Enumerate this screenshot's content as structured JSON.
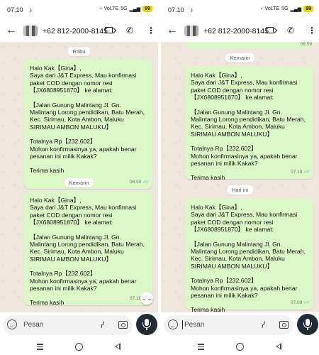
{
  "status_bar": {
    "time": "07.10",
    "battery": "99",
    "signal_labels": [
      "VoLTE",
      "5G"
    ]
  },
  "header": {
    "phone": "+62 812-2000-8145"
  },
  "icons": {
    "back": "arrow-back-icon",
    "label": "label-icon",
    "call": "add-call-icon",
    "menu": "more-vert-icon",
    "emoji": "emoji-icon",
    "attach": "attach-icon",
    "camera": "camera-icon",
    "mic": "mic-icon"
  },
  "message": {
    "greeting": "Halo Kak【Gina】,",
    "intro": "Saya dari J&T Express, Mau konfirmasi paket COD dengan nomor resi 【JX6808951870】 ke alamat:",
    "address": "【Jalan Gunung Malintang  Jl. Gn. Malintang Lorong pendidikan, Batu Merah, Kec. Sirimau, Kota Ambon, Maluku SIRIMAU AMBON MALUKU】",
    "total": "Totalnya Rp【232,602】",
    "ask": "Mohon konfirmasinya ya, apakah benar pesanan ini milik Kakak?",
    "thanks": "Terima kasih"
  },
  "left_pane": {
    "date_1": "Rabu",
    "time_1": "06.59",
    "date_2": "Kemarin",
    "time_2": "07.18"
  },
  "right_pane": {
    "partial_time": "06.59",
    "date_1": "Kemarin",
    "time_1": "07.18",
    "date_2": "Hari ini",
    "time_2": "07.09"
  },
  "composer": {
    "placeholder": "Pesan"
  },
  "colors": {
    "bubble": "#dcf8c6",
    "chat_bg": "#efe7dd",
    "ticks": "#4fb6ec",
    "mic_button": "#1f2c34",
    "battery": "#e6d800"
  }
}
